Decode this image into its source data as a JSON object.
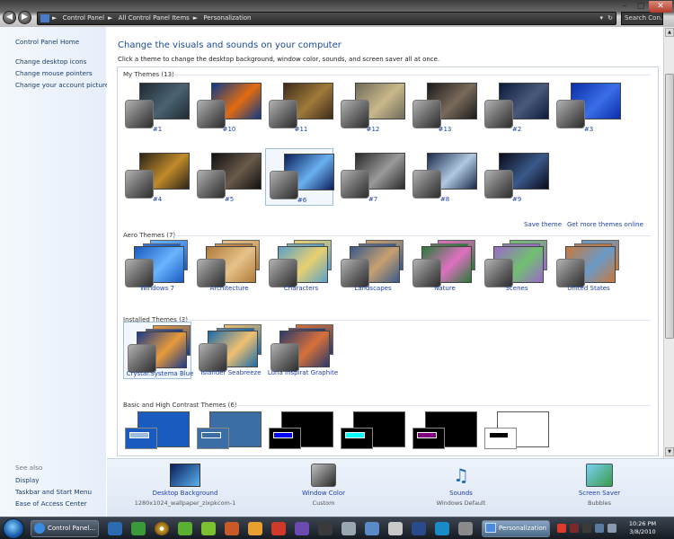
{
  "window": {
    "breadcrumb": [
      "Control Panel",
      "All Control Panel Items",
      "Personalization"
    ],
    "search_placeholder": "Search Con..."
  },
  "left_pane": {
    "home": "Control Panel Home",
    "links": [
      "Change desktop icons",
      "Change mouse pointers",
      "Change your account picture"
    ],
    "see_also_title": "See also",
    "see_also": [
      "Display",
      "Taskbar and Start Menu",
      "Ease of Access Center"
    ]
  },
  "main": {
    "heading": "Change the visuals and sounds on your computer",
    "subheading": "Click a theme to change the desktop background, window color, sounds, and screen saver all at once.",
    "sections": {
      "my_themes": "My Themes (13)",
      "aero_themes": "Aero Themes (7)",
      "installed_themes": "Installed Themes (3)",
      "basic_themes": "Basic and High Contrast Themes (6)"
    },
    "my_themes": [
      {
        "name": "#1",
        "colors": [
          "#1f2a33",
          "#4a6272"
        ]
      },
      {
        "name": "#10",
        "colors": [
          "#0b3a86",
          "#e36b12"
        ]
      },
      {
        "name": "#11",
        "colors": [
          "#3d2b1a",
          "#a07a3a"
        ]
      },
      {
        "name": "#12",
        "colors": [
          "#6f6a5a",
          "#c9b88a"
        ]
      },
      {
        "name": "#13",
        "colors": [
          "#1b1b1b",
          "#7a6a5a"
        ]
      },
      {
        "name": "#2",
        "colors": [
          "#0c1a3a",
          "#4a5a7a"
        ]
      },
      {
        "name": "#3",
        "colors": [
          "#0a2ea8",
          "#3a6ee8"
        ]
      },
      {
        "name": "#4",
        "colors": [
          "#2a2418",
          "#c08a2a"
        ]
      },
      {
        "name": "#5",
        "colors": [
          "#101010",
          "#6a5a4a"
        ]
      },
      {
        "name": "#6",
        "colors": [
          "#0a1e5a",
          "#6ab0f0"
        ]
      },
      {
        "name": "#7",
        "colors": [
          "#2a2a2a",
          "#9a9a9a"
        ]
      },
      {
        "name": "#8",
        "colors": [
          "#1a2a4a",
          "#b0c8e0"
        ]
      },
      {
        "name": "#9",
        "colors": [
          "#0a0a1a",
          "#3a5a8a"
        ]
      }
    ],
    "save_theme": "Save theme",
    "get_more": "Get more themes online",
    "aero": [
      {
        "name": "Windows 7",
        "colors": [
          "#1a5bbf",
          "#6ab4ff"
        ]
      },
      {
        "name": "Architecture",
        "colors": [
          "#b07a3a",
          "#e6c28a"
        ]
      },
      {
        "name": "Characters",
        "colors": [
          "#5aa0c8",
          "#e8d070"
        ]
      },
      {
        "name": "Landscapes",
        "colors": [
          "#3a5a8a",
          "#c8a070"
        ]
      },
      {
        "name": "Nature",
        "colors": [
          "#2a7a3a",
          "#e070c0"
        ]
      },
      {
        "name": "Scenes",
        "colors": [
          "#9a6ac8",
          "#70c070"
        ]
      },
      {
        "name": "United States",
        "colors": [
          "#c8783a",
          "#6a9ac8"
        ]
      }
    ],
    "installed": [
      {
        "name": "Crystal.Systema Blue",
        "colors": [
          "#1a3a8a",
          "#e89a3a"
        ]
      },
      {
        "name": "Islander Seabreeze",
        "colors": [
          "#1a6aa8",
          "#f0c070"
        ]
      },
      {
        "name": "Luna Inspirat Graphite",
        "colors": [
          "#2a3a6a",
          "#d8703a"
        ]
      }
    ],
    "basic": [
      {
        "colors": [
          "#1a5bbf",
          "#9bbde0"
        ]
      },
      {
        "colors": [
          "#3a6ea5",
          "#3a6ea5"
        ]
      },
      {
        "colors": [
          "#000000",
          "#0000ff"
        ]
      },
      {
        "colors": [
          "#000000",
          "#00ffff"
        ]
      },
      {
        "colors": [
          "#000000",
          "#800080"
        ]
      },
      {
        "colors": [
          "#ffffff",
          "#000000"
        ]
      }
    ]
  },
  "bottom": [
    {
      "title": "Desktop Background",
      "sub": "1280x1024_wallpaper_zixpkcom-1"
    },
    {
      "title": "Window Color",
      "sub": "Custom"
    },
    {
      "title": "Sounds",
      "sub": "Windows Default"
    },
    {
      "title": "Screen Saver",
      "sub": "Bubbles"
    }
  ],
  "taskbar": {
    "ie_label": "Control Panel...",
    "personalization_label": "Personalization",
    "time": "10:26 PM",
    "date": "3/8/2010"
  }
}
